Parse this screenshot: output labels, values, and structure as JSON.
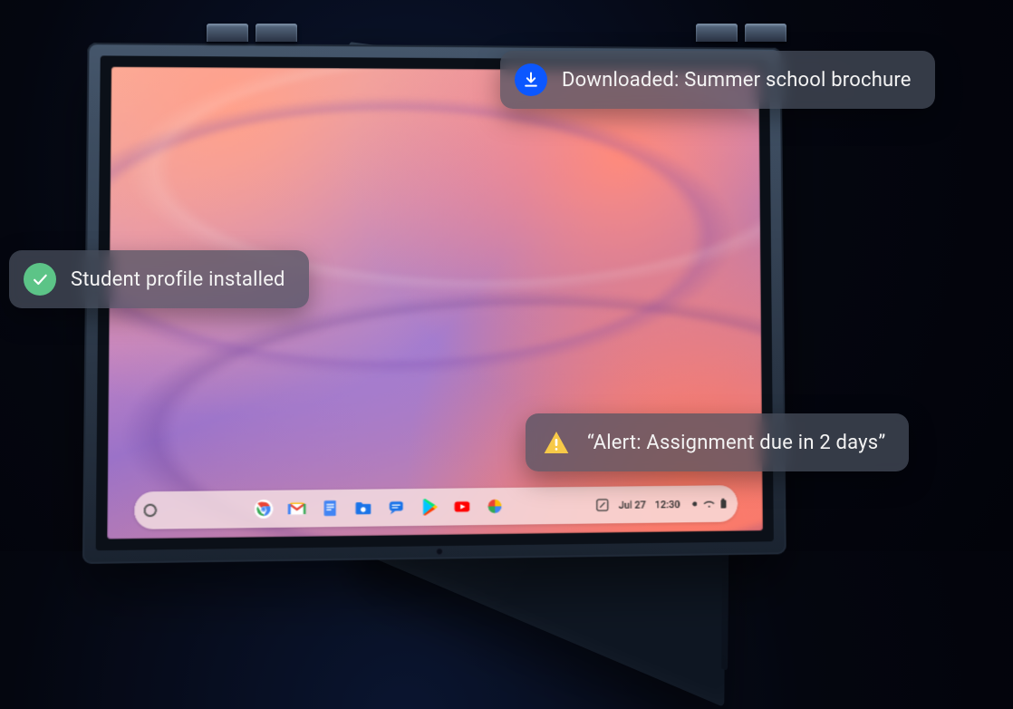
{
  "notifications": {
    "download": {
      "text": "Downloaded: Summer school brochure"
    },
    "installed": {
      "text": "Student profile installed"
    },
    "alert": {
      "text": "“Alert: Assignment due in 2 days”"
    }
  },
  "shelf": {
    "date": "Jul 27",
    "time": "12:30"
  }
}
